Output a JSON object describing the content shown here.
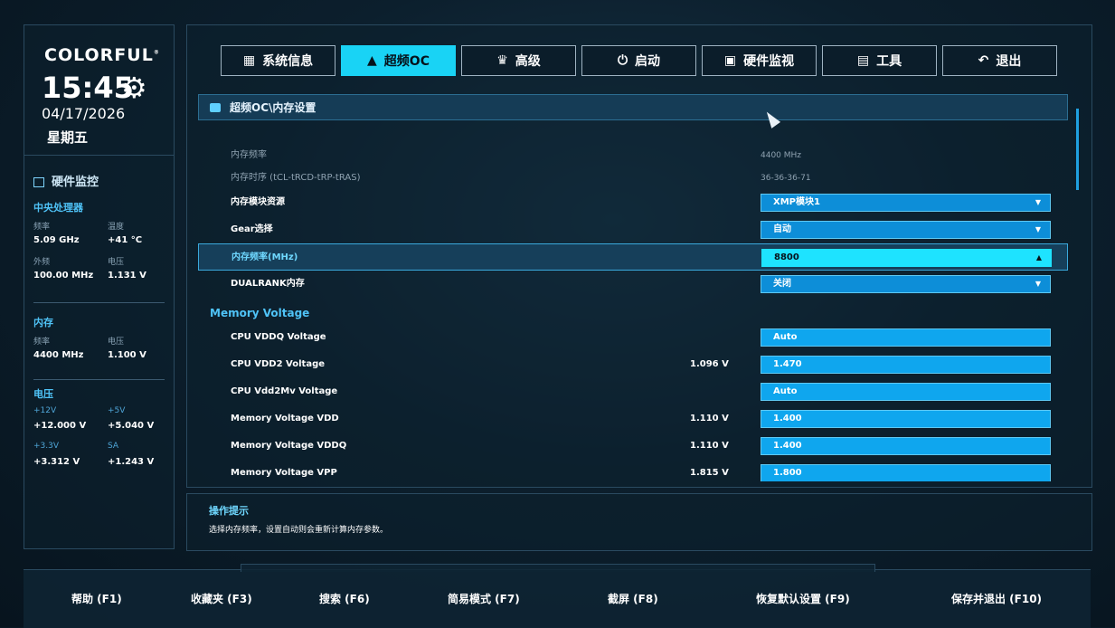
{
  "sidebar": {
    "brand": "COLORFUL",
    "brand_mark": "®",
    "time": "15:45",
    "date": "04/17/2026",
    "weekday": "星期五",
    "hw_title": "硬件监控",
    "cpu": {
      "title": "中央处理器",
      "freq_label": "频率",
      "freq_value": "5.09 GHz",
      "temp_label": "温度",
      "temp_value": "+41 °C",
      "bclk_label": "外频",
      "bclk_value": "100.00 MHz",
      "volt_label": "电压",
      "volt_value": "1.131 V"
    },
    "memory": {
      "title": "内存",
      "freq_label": "频率",
      "freq_value": "4400 MHz",
      "volt_label": "电压",
      "volt_value": "1.100 V"
    },
    "voltage": {
      "title": "电压",
      "v12_label": "+12V",
      "v12_value": "+12.000 V",
      "v5_label": "+5V",
      "v5_value": "+5.040 V",
      "v33_label": "+3.3V",
      "v33_value": "+3.312 V",
      "sa_label": "SA",
      "sa_value": "+1.243 V"
    }
  },
  "tabs": [
    {
      "label": "系统信息",
      "icon": "grid-icon"
    },
    {
      "label": "超频OC",
      "icon": "rocket-icon"
    },
    {
      "label": "高级",
      "icon": "crown-icon"
    },
    {
      "label": "启动",
      "icon": "power-icon"
    },
    {
      "label": "硬件监视",
      "icon": "monitor-icon"
    },
    {
      "label": "工具",
      "icon": "toolbox-icon"
    },
    {
      "label": "退出",
      "icon": "back-arrow-icon"
    }
  ],
  "breadcrumb": "超频OC\\内存设置",
  "rows": {
    "mem_freq": {
      "label": "内存频率",
      "value": "4400 MHz"
    },
    "mem_timing": {
      "label": "内存时序 (tCL-tRCD-tRP-tRAS)",
      "value": "36-36-36-71"
    },
    "module_source": {
      "label": "内存模块资源",
      "value": "XMP模块1"
    },
    "gear": {
      "label": "Gear选择",
      "value": "自动"
    },
    "mem_freq_mhz": {
      "label": "内存频率(MHz)",
      "value": "8800"
    },
    "dualrank": {
      "label": "DUALRANK内存",
      "value": "关闭"
    },
    "group_voltage": "Memory Voltage",
    "vddq": {
      "label": "CPU VDDQ Voltage",
      "value": "Auto"
    },
    "vdd2": {
      "label": "CPU VDD2 Voltage",
      "measured": "1.096 V",
      "value": "1.470"
    },
    "vdd2mv": {
      "label": "CPU Vdd2Mv Voltage",
      "value": "Auto"
    },
    "vdd": {
      "label": "Memory Voltage VDD",
      "measured": "1.110 V",
      "value": "1.400"
    },
    "vddq_mem": {
      "label": "Memory Voltage VDDQ",
      "measured": "1.110 V",
      "value": "1.400"
    },
    "vpp": {
      "label": "Memory Voltage VPP",
      "measured": "1.815 V",
      "value": "1.800"
    }
  },
  "hint": {
    "title": "操作提示",
    "text": "选择内存频率，设置自动则会重新计算内存参数。"
  },
  "footer": [
    "帮助 (F1)",
    "收藏夹 (F3)",
    "搜索 (F6)",
    "简易模式 (F7)",
    "截屏 (F8)",
    "恢复默认设置 (F9)",
    "保存并退出 (F10)"
  ],
  "colors": {
    "accent": "#19d3f5",
    "dropdown": "#0d8ed8",
    "label_cyan": "#4fc3f7"
  }
}
